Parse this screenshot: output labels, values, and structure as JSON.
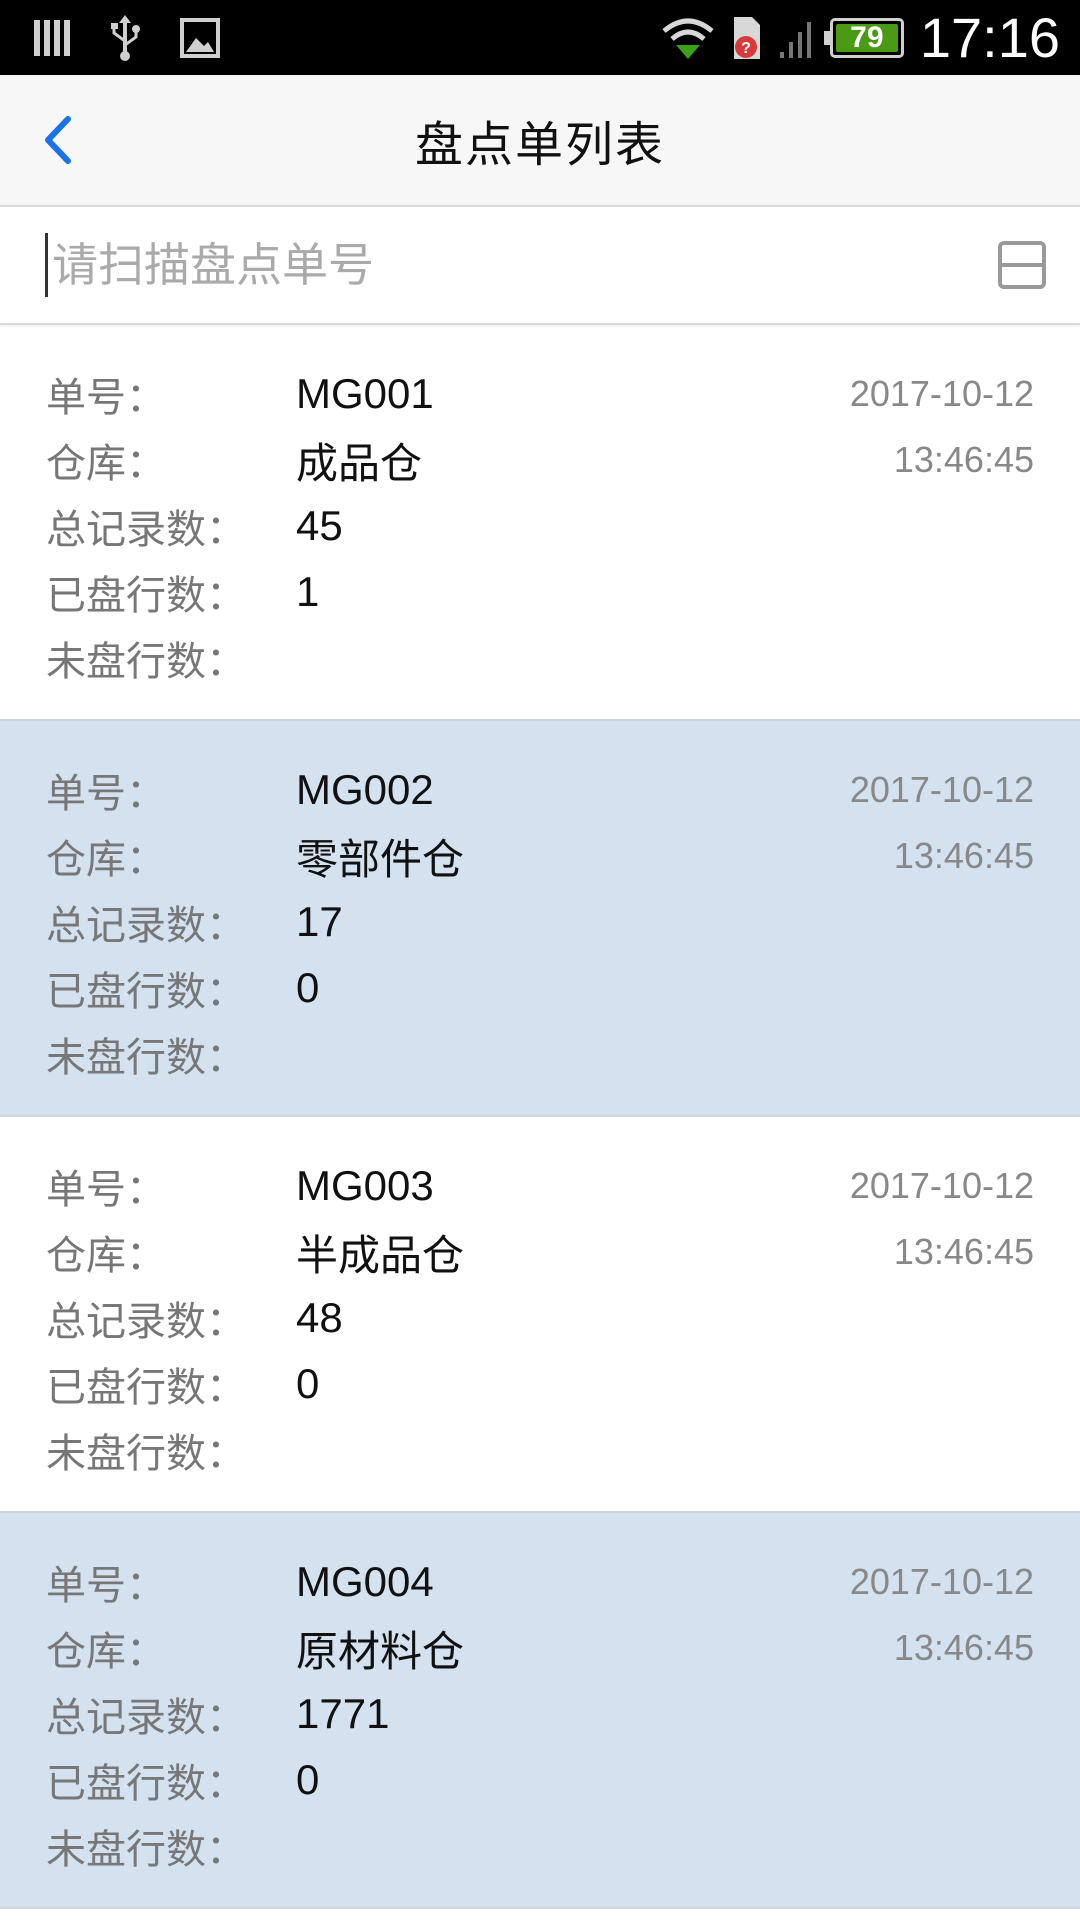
{
  "status_bar": {
    "battery": "79",
    "time": "17:16",
    "icons": [
      "notification-bars-icon",
      "usb-icon",
      "image-icon",
      "wifi-icon",
      "sim-alert-icon",
      "signal-icon",
      "battery-icon"
    ]
  },
  "header": {
    "title": "盘点单列表"
  },
  "search": {
    "placeholder": "请扫描盘点单号",
    "value": ""
  },
  "labels": {
    "number": "单号：",
    "warehouse": "仓库：",
    "total": "总记录数：",
    "done": "已盘行数：",
    "pending": "未盘行数："
  },
  "orders": [
    {
      "number": "MG001",
      "warehouse": "成品仓",
      "total": "45",
      "done": "1",
      "pending": "",
      "date": "2017-10-12",
      "time": "13:46:45"
    },
    {
      "number": "MG002",
      "warehouse": "零部件仓",
      "total": "17",
      "done": "0",
      "pending": "",
      "date": "2017-10-12",
      "time": "13:46:45"
    },
    {
      "number": "MG003",
      "warehouse": "半成品仓",
      "total": "48",
      "done": "0",
      "pending": "",
      "date": "2017-10-12",
      "time": "13:46:45"
    },
    {
      "number": "MG004",
      "warehouse": "原材料仓",
      "total": "1771",
      "done": "0",
      "pending": "",
      "date": "2017-10-12",
      "time": "13:46:45"
    }
  ],
  "colors": {
    "accent": "#1a73e8",
    "alt_row": "#d4e1ef",
    "battery_fill": "#4a9a16"
  }
}
